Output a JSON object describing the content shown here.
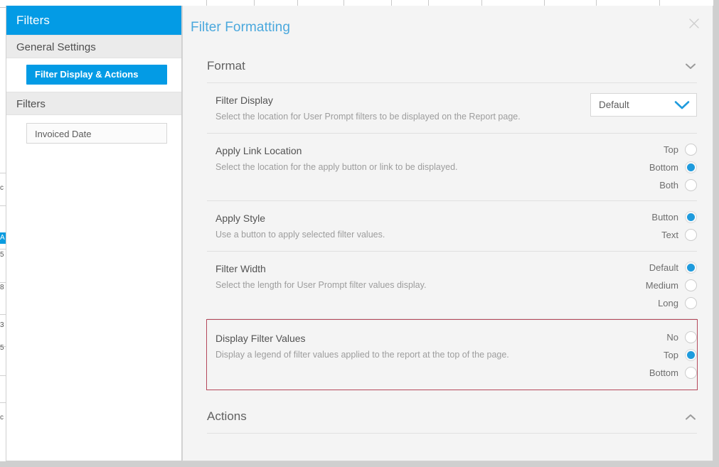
{
  "background": {
    "cells": [
      "c",
      "A",
      "5",
      "8",
      "3",
      "5",
      "c"
    ]
  },
  "sidebar": {
    "title": "Filters",
    "sections": [
      {
        "heading": "General Settings",
        "items": [
          {
            "label": "Filter Display & Actions",
            "selected": true
          }
        ]
      },
      {
        "heading": "Filters",
        "items": [
          {
            "label": "Invoiced Date",
            "selected": false
          }
        ]
      }
    ],
    "general_settings_heading": "General Settings",
    "nav_item_label": "Filter Display & Actions",
    "filters_heading": "Filters",
    "filter_chip_label": "Invoiced Date"
  },
  "modal": {
    "title": "Filter Formatting",
    "close_icon": "close-icon",
    "accordions": [
      {
        "label": "Format",
        "expanded": true,
        "chevron": "chevron-down-icon"
      },
      {
        "label": "Actions",
        "expanded": false,
        "chevron": "chevron-up-icon"
      }
    ],
    "format_label": "Format",
    "actions_label": "Actions",
    "rows": [
      {
        "name": "filter-display",
        "label": "Filter Display",
        "description": "Select the location for User Prompt filters to be displayed on the Report page.",
        "control": "select",
        "value": "Default",
        "options": [
          "Default"
        ]
      },
      {
        "name": "apply-link-location",
        "label": "Apply Link Location",
        "description": "Select the location for the apply button or link to be displayed.",
        "control": "radio",
        "options": [
          {
            "label": "Top",
            "selected": false
          },
          {
            "label": "Bottom",
            "selected": true
          },
          {
            "label": "Both",
            "selected": false
          }
        ]
      },
      {
        "name": "apply-style",
        "label": "Apply Style",
        "description": "Use a button to apply selected filter values.",
        "control": "radio",
        "options": [
          {
            "label": "Button",
            "selected": true
          },
          {
            "label": "Text",
            "selected": false
          }
        ]
      },
      {
        "name": "filter-width",
        "label": "Filter Width",
        "description": "Select the length for User Prompt filter values display.",
        "control": "radio",
        "options": [
          {
            "label": "Default",
            "selected": true
          },
          {
            "label": "Medium",
            "selected": false
          },
          {
            "label": "Long",
            "selected": false
          }
        ]
      },
      {
        "name": "display-filter-values",
        "label": "Display Filter Values",
        "description": "Display a legend of filter values applied to the report at the top of the page.",
        "control": "radio",
        "highlighted": true,
        "options": [
          {
            "label": "No",
            "selected": false
          },
          {
            "label": "Top",
            "selected": true
          },
          {
            "label": "Bottom",
            "selected": false
          }
        ]
      }
    ]
  },
  "colors": {
    "accent_blue": "#039be5",
    "title_blue": "#4aa8dd",
    "radio_blue": "#1f9bdd",
    "highlight_border": "#b5485b",
    "panel_bg": "#f4f4f4"
  }
}
